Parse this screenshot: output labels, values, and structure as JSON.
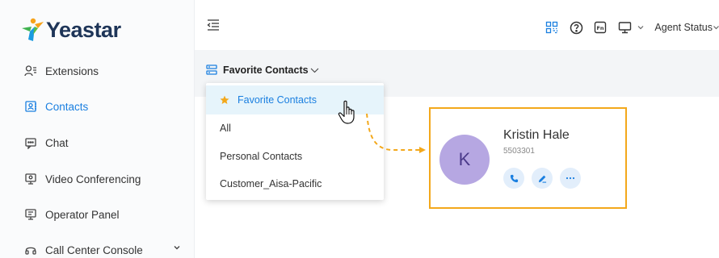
{
  "app": {
    "brand_name": "Yeastar"
  },
  "sidebar": {
    "items": [
      {
        "label": "Extensions",
        "icon": "user-list-icon",
        "active": false
      },
      {
        "label": "Contacts",
        "icon": "contacts-book-icon",
        "active": true
      },
      {
        "label": "Chat",
        "icon": "chat-icon",
        "active": false
      },
      {
        "label": "Video Conferencing",
        "icon": "video-monitor-icon",
        "active": false
      },
      {
        "label": "Operator Panel",
        "icon": "operator-panel-icon",
        "active": false
      },
      {
        "label": "Call Center Console",
        "icon": "headset-icon",
        "active": false,
        "has_submenu": true
      }
    ]
  },
  "topbar": {
    "icons": [
      "qr-code-icon",
      "help-circle-icon",
      "fn-key-icon",
      "monitor-icon",
      "chevron-down-icon"
    ],
    "agent_status_label": "Agent Status"
  },
  "contacts": {
    "selected_group": "Favorite Contacts",
    "dropdown_options": [
      {
        "label": "Favorite Contacts",
        "starred": true,
        "selected": true
      },
      {
        "label": "All",
        "starred": false,
        "selected": false
      },
      {
        "label": "Personal Contacts",
        "starred": false,
        "selected": false
      },
      {
        "label": "Customer_Aisa-Pacific",
        "starred": false,
        "selected": false
      }
    ],
    "card": {
      "avatar_letter": "K",
      "name": "Kristin Hale",
      "number": "5503301",
      "actions": [
        "phone-icon",
        "edit-icon",
        "more-icon"
      ]
    }
  },
  "colors": {
    "accent": "#1a7fe0",
    "highlight_border": "#f3a81b",
    "avatar_bg": "#b6a7e2",
    "selected_bg": "#e6f4fb"
  }
}
